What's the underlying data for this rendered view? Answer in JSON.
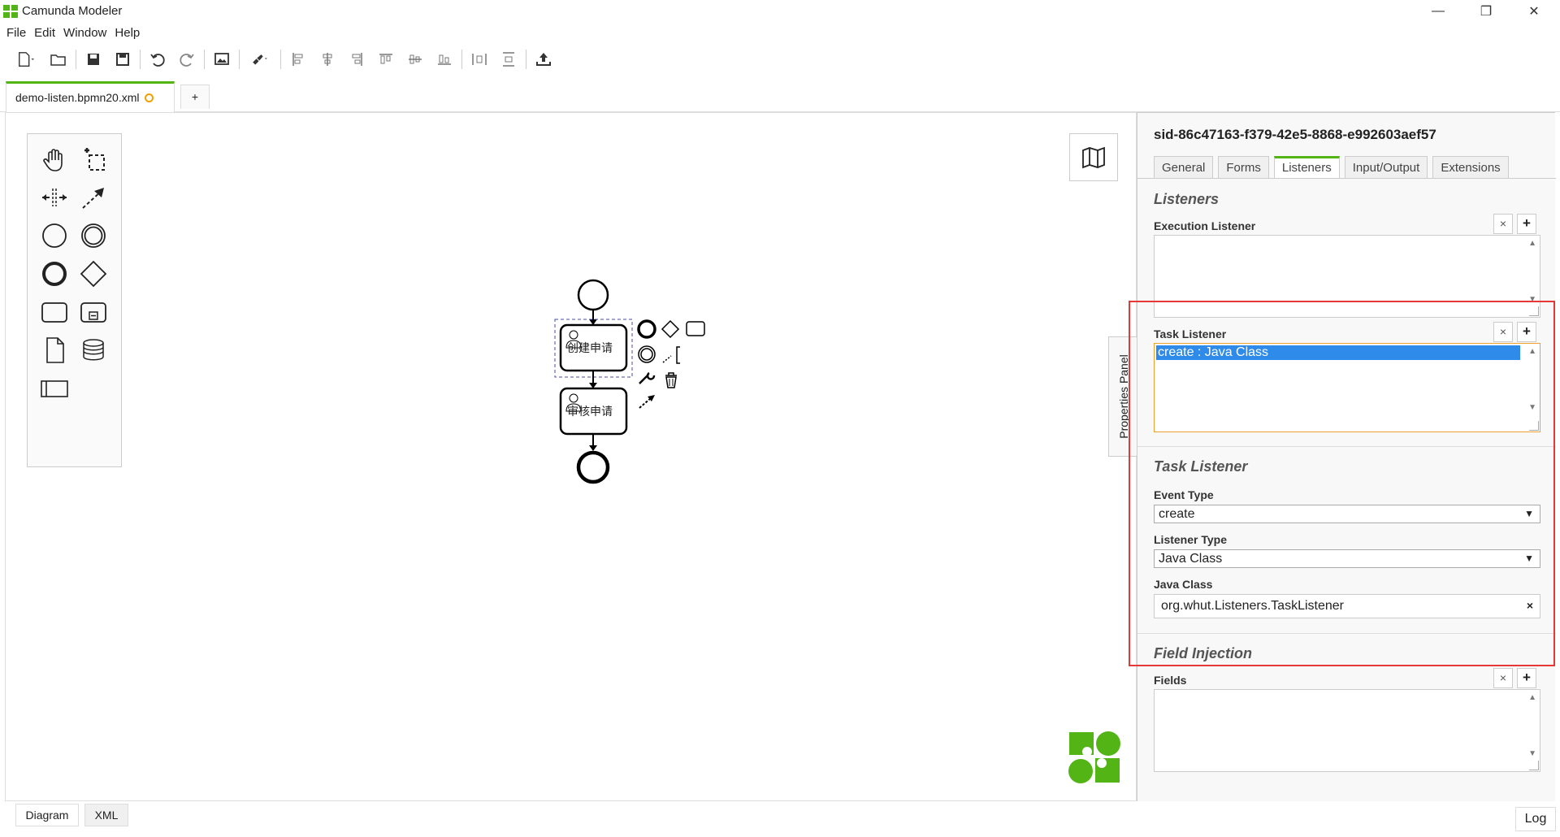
{
  "app": {
    "title": "Camunda Modeler"
  },
  "menu": [
    "File",
    "Edit",
    "Window",
    "Help"
  ],
  "tabs": {
    "file_tab": "demo-listen.bpmn20.xml",
    "add_tab": "+"
  },
  "diagram": {
    "task1_label": "创建申请",
    "task2_label": "审核申请"
  },
  "properties_toggle": "Properties Panel",
  "properties": {
    "element_id": "sid-86c47163-f379-42e5-8868-e992603aef57",
    "tabs": [
      "General",
      "Forms",
      "Listeners",
      "Input/Output",
      "Extensions"
    ],
    "active_tab": "Listeners",
    "listeners_section": "Listeners",
    "execution_listener_label": "Execution Listener",
    "task_listener_label": "Task Listener",
    "task_listener_selected": "create : Java Class",
    "task_listener_section": "Task Listener",
    "event_type_label": "Event Type",
    "event_type_value": "create",
    "listener_type_label": "Listener Type",
    "listener_type_value": "Java Class",
    "java_class_label": "Java Class",
    "java_class_value": "org.whut.Listeners.TaskListener",
    "field_injection_section": "Field Injection",
    "fields_label": "Fields",
    "remove_symbol": "×",
    "add_symbol": "+",
    "caret": "▼"
  },
  "bottom": {
    "diagram_tab": "Diagram",
    "xml_tab": "XML",
    "log_button": "Log"
  },
  "colors": {
    "accent": "#52b415",
    "selection": "#2f8bea",
    "highlight": "#e53935",
    "dirty": "#f0a000"
  }
}
